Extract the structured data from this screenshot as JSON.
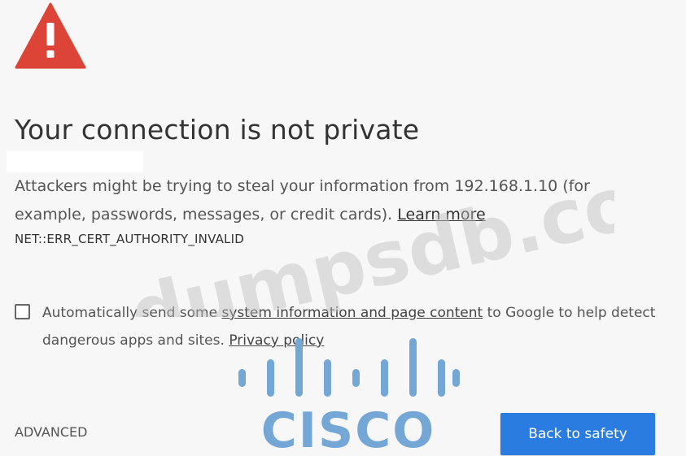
{
  "interstitial": {
    "title": "Your connection is not private",
    "description": "Attackers might be trying to steal your information from 192.168.1.10 (for example, passwords, messages, or credit cards).",
    "learn_more": "Learn more",
    "error_code": "NET::ERR_CERT_AUTHORITY_INVALID",
    "optin": {
      "prefix": "Automatically send some ",
      "link": "system information and page content",
      "suffix": " to Google to help detect dangerous apps and sites.",
      "privacy_link": "Privacy policy",
      "checked": false
    },
    "advanced_label": "ADVANCED",
    "back_label": "Back to safety"
  },
  "overlay": {
    "watermark_text": "dumpsdb.com",
    "logo_text": "CISCO"
  },
  "colors": {
    "warning_red": "#db4437",
    "button_blue": "#2a7ce0",
    "cisco_blue": "#74a7d6",
    "background": "#f7f7f7"
  },
  "icons": {
    "warning": "warning-triangle-icon",
    "checkbox": "checkbox-unchecked"
  }
}
